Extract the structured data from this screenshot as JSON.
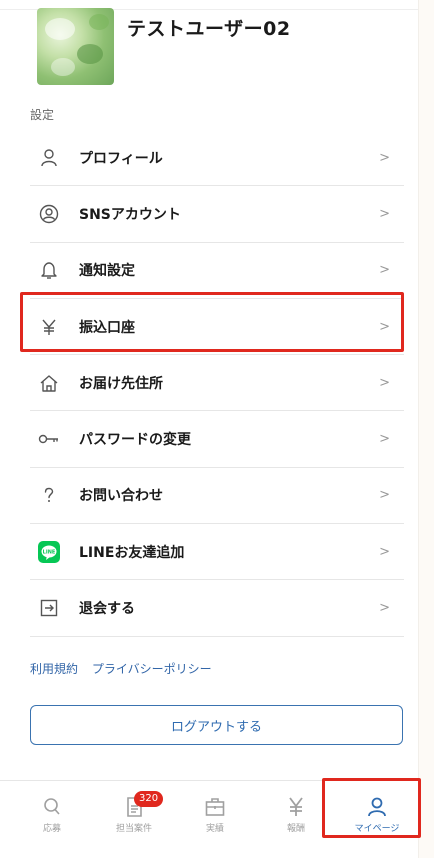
{
  "profile": {
    "name": "テストユーザー02"
  },
  "settings": {
    "section_label": "設定",
    "items": [
      {
        "label": "プロフィール",
        "icon": "person-icon"
      },
      {
        "label": "SNSアカウント",
        "icon": "account-circle-icon"
      },
      {
        "label": "通知設定",
        "icon": "bell-icon"
      },
      {
        "label": "振込口座",
        "icon": "yen-icon"
      },
      {
        "label": "お届け先住所",
        "icon": "home-icon"
      },
      {
        "label": "パスワードの変更",
        "icon": "key-icon"
      },
      {
        "label": "お問い合わせ",
        "icon": "question-icon"
      },
      {
        "label": "LINEお友達追加",
        "icon": "line-icon"
      },
      {
        "label": "退会する",
        "icon": "exit-icon"
      }
    ],
    "chevron": ">"
  },
  "links": {
    "terms": "利用規約",
    "privacy": "プライバシーポリシー"
  },
  "logout": {
    "label": "ログアウトする"
  },
  "bottom_nav": {
    "items": [
      {
        "label": "応募",
        "icon": "search-icon"
      },
      {
        "label": "担当案件",
        "icon": "document-icon",
        "badge": "320"
      },
      {
        "label": "実績",
        "icon": "briefcase-icon"
      },
      {
        "label": "報酬",
        "icon": "yen-icon"
      },
      {
        "label": "マイページ",
        "icon": "person-icon",
        "active": true
      }
    ]
  },
  "colors": {
    "accent": "#2f6bb0",
    "highlight": "#e0281e",
    "line_green": "#06c755",
    "badge": "#e0281e"
  }
}
